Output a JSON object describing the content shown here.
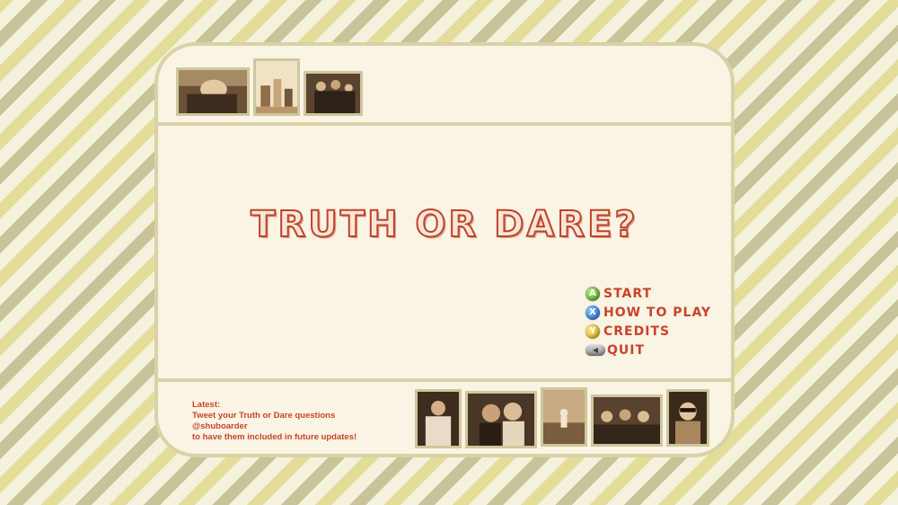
{
  "title": "TRUTH OR DARE?",
  "menu": {
    "items": [
      {
        "button": "A",
        "label": "START"
      },
      {
        "button": "X",
        "label": "HOW TO PLAY"
      },
      {
        "button": "Y",
        "label": "CREDITS"
      },
      {
        "button": "◀",
        "label": "QUIT"
      }
    ]
  },
  "latest": {
    "heading": "Latest:",
    "line1": "Tweet your Truth or Dare questions @shuboarder",
    "line2": "to have them included in future updates!"
  },
  "colors": {
    "accent": "#c9432b",
    "panel": "#f9f4e4",
    "border": "#d8d2a6"
  },
  "icons": {
    "a_button": "green-a-button-icon",
    "x_button": "blue-x-button-icon",
    "y_button": "yellow-y-button-icon",
    "back_button": "back-button-icon"
  }
}
